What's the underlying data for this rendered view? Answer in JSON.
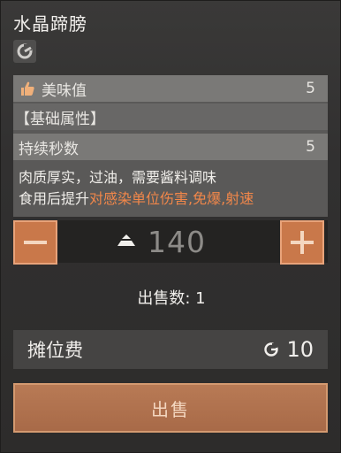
{
  "item": {
    "name": "水晶蹄膀",
    "type_icon": "food-category-icon"
  },
  "stats": {
    "taste_label": "美味值",
    "taste_value": "5",
    "section_header": "【基础属性】",
    "duration_label": "持续秒数",
    "duration_value": "5"
  },
  "description": {
    "line1": "肉质厚实，过油，需要酱料调味",
    "line2_prefix": "食用后提升",
    "line2_hl1": "对感染单位伤害",
    "line2_sep1": ",",
    "line2_hl2": "免爆",
    "line2_sep2": ",",
    "line2_hl3": "射速"
  },
  "quantity": {
    "minus_icon": "minus-icon",
    "plus_icon": "plus-icon",
    "value": "140"
  },
  "sale": {
    "count_label": "出售数: 1",
    "fee_label": "摊位费",
    "fee_amount": "10",
    "sell_button": "出售"
  },
  "colors": {
    "accent_orange": "#c9784a",
    "highlight_text": "#f1874a"
  }
}
